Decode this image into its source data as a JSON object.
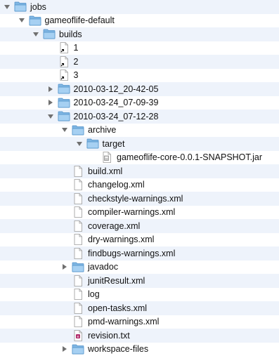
{
  "colors": {
    "stripe": "#eef3fb",
    "folder_back": "#7fb6e3",
    "folder_front": "#a6d0f2",
    "folder_edge": "#4d8fc8",
    "triangle": "#707070",
    "doc_fill": "#ffffff",
    "doc_edge": "#9a9a9a"
  },
  "tree": [
    {
      "label": "jobs",
      "kind": "folder",
      "state": "open",
      "depth": 0
    },
    {
      "label": "gameoflife-default",
      "kind": "folder",
      "state": "open",
      "depth": 1
    },
    {
      "label": "builds",
      "kind": "folder",
      "state": "open",
      "depth": 2
    },
    {
      "label": "1",
      "kind": "alias",
      "state": "none",
      "depth": 3
    },
    {
      "label": "2",
      "kind": "alias",
      "state": "none",
      "depth": 3
    },
    {
      "label": "3",
      "kind": "alias",
      "state": "none",
      "depth": 3
    },
    {
      "label": "2010-03-12_20-42-05",
      "kind": "folder",
      "state": "closed",
      "depth": 3
    },
    {
      "label": "2010-03-24_07-09-39",
      "kind": "folder",
      "state": "closed",
      "depth": 3
    },
    {
      "label": "2010-03-24_07-12-28",
      "kind": "folder",
      "state": "open",
      "depth": 3
    },
    {
      "label": "archive",
      "kind": "folder",
      "state": "open",
      "depth": 4
    },
    {
      "label": "target",
      "kind": "folder",
      "state": "open",
      "depth": 5
    },
    {
      "label": "gameoflife-core-0.0.1-SNAPSHOT.jar",
      "kind": "jar",
      "state": "none",
      "depth": 6
    },
    {
      "label": "build.xml",
      "kind": "file",
      "state": "none",
      "depth": 4
    },
    {
      "label": "changelog.xml",
      "kind": "file",
      "state": "none",
      "depth": 4
    },
    {
      "label": "checkstyle-warnings.xml",
      "kind": "file",
      "state": "none",
      "depth": 4
    },
    {
      "label": "compiler-warnings.xml",
      "kind": "file",
      "state": "none",
      "depth": 4
    },
    {
      "label": "coverage.xml",
      "kind": "file",
      "state": "none",
      "depth": 4
    },
    {
      "label": "dry-warnings.xml",
      "kind": "file",
      "state": "none",
      "depth": 4
    },
    {
      "label": "findbugs-warnings.xml",
      "kind": "file",
      "state": "none",
      "depth": 4
    },
    {
      "label": "javadoc",
      "kind": "folder",
      "state": "closed",
      "depth": 4
    },
    {
      "label": "junitResult.xml",
      "kind": "file",
      "state": "none",
      "depth": 4
    },
    {
      "label": "log",
      "kind": "file",
      "state": "none",
      "depth": 4
    },
    {
      "label": "open-tasks.xml",
      "kind": "file",
      "state": "none",
      "depth": 4
    },
    {
      "label": "pmd-warnings.xml",
      "kind": "file",
      "state": "none",
      "depth": 4
    },
    {
      "label": "revision.txt",
      "kind": "text",
      "state": "none",
      "depth": 4
    },
    {
      "label": "workspace-files",
      "kind": "folder",
      "state": "closed",
      "depth": 4
    }
  ]
}
